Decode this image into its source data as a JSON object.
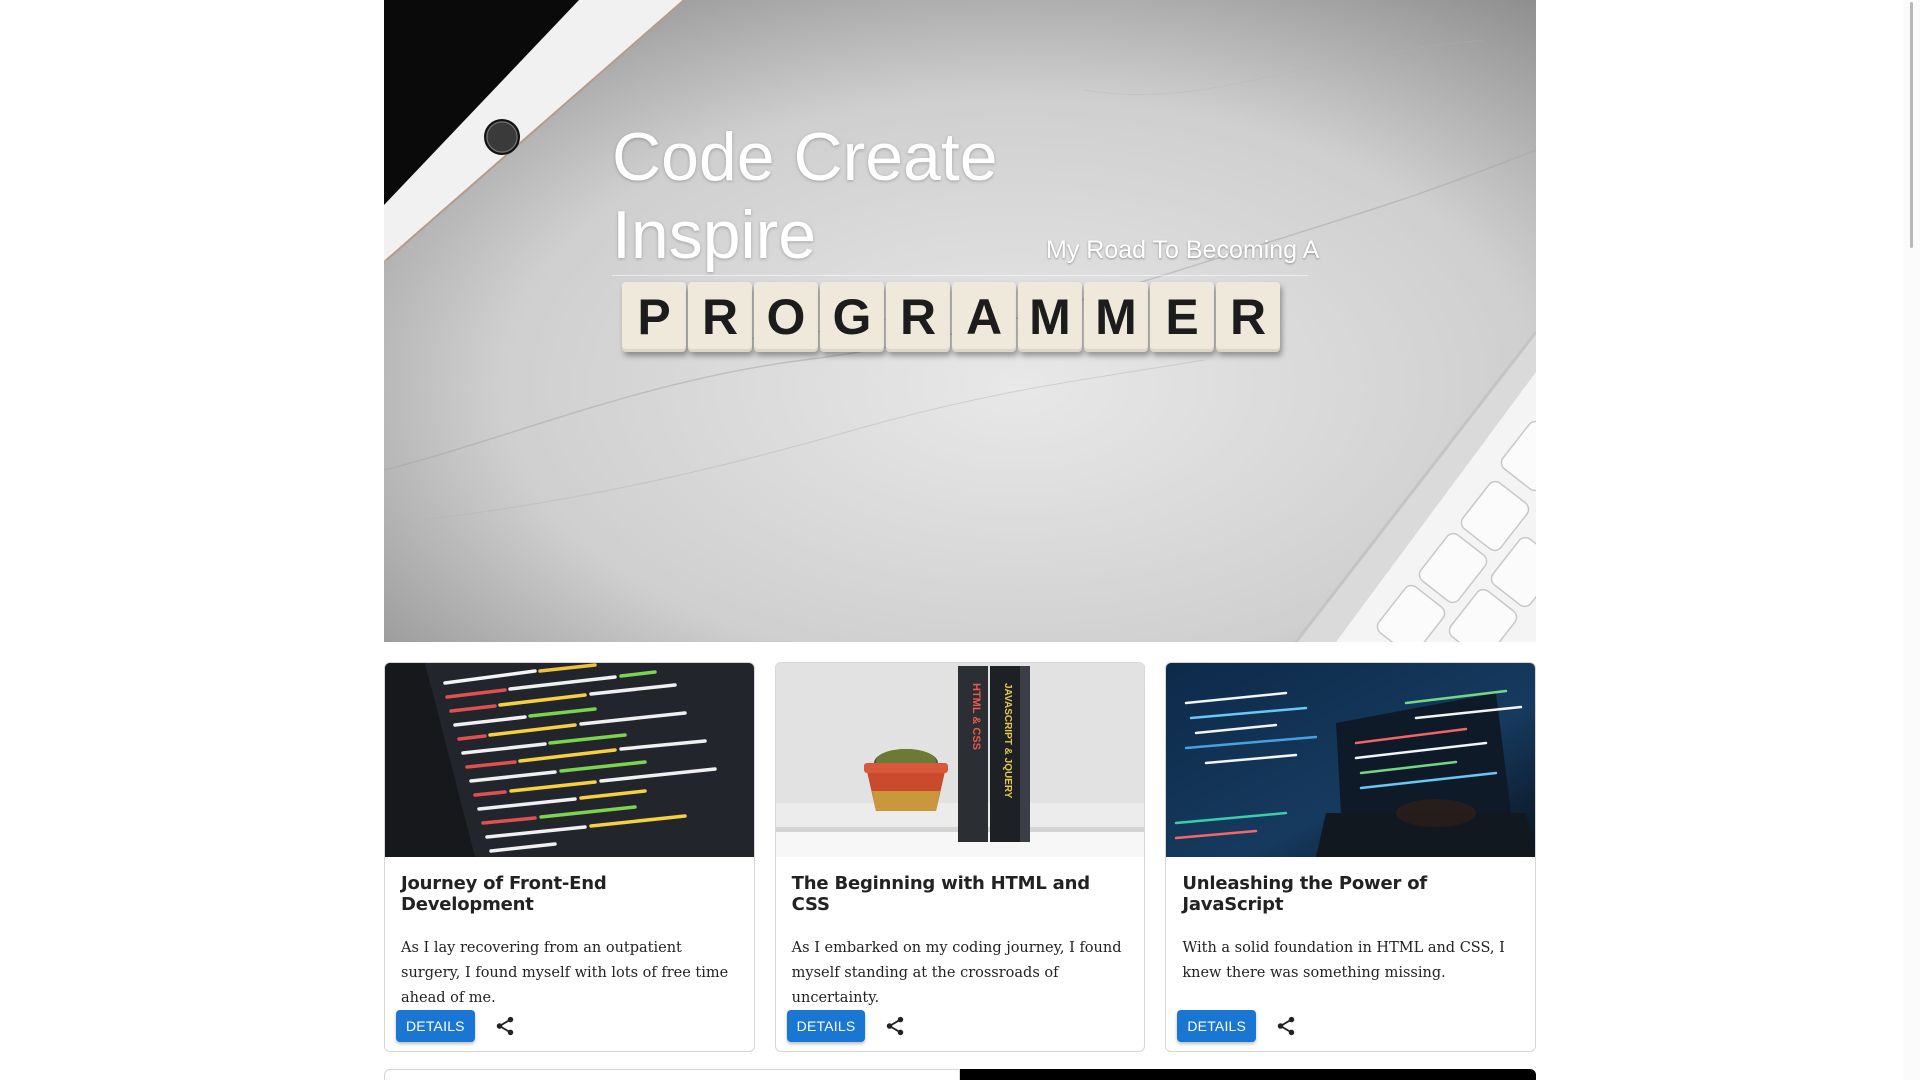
{
  "hero": {
    "title": "Code Create Inspire",
    "subtitle": "My Road To Becoming A",
    "tiles": [
      "P",
      "R",
      "O",
      "G",
      "R",
      "A",
      "M",
      "M",
      "E",
      "R"
    ]
  },
  "cards": [
    {
      "title": "Journey of Front-End Development",
      "text": "As I lay recovering from an outpatient surgery, I found myself with lots of free time ahead of me.",
      "button": "DETAILS",
      "image": "code-on-screen"
    },
    {
      "title": "The Beginning with HTML and CSS",
      "text": "As I embarked on my coding journey, I found myself standing at the crossroads of uncertainty.",
      "button": "DETAILS",
      "image": "books-and-cactus",
      "book1_spine": "HTML & CSS",
      "book2_spine": "JAVASCRIPT & JQUERY"
    },
    {
      "title": "Unleashing the Power of JavaScript",
      "text": "With a solid foundation in HTML and CSS, I knew there was something missing.",
      "button": "DETAILS",
      "image": "laptop-with-code-overlay"
    }
  ],
  "icons": {
    "share": "share-icon"
  },
  "colors": {
    "accent": "#1976d2",
    "card_border": "#d6d6d6"
  }
}
